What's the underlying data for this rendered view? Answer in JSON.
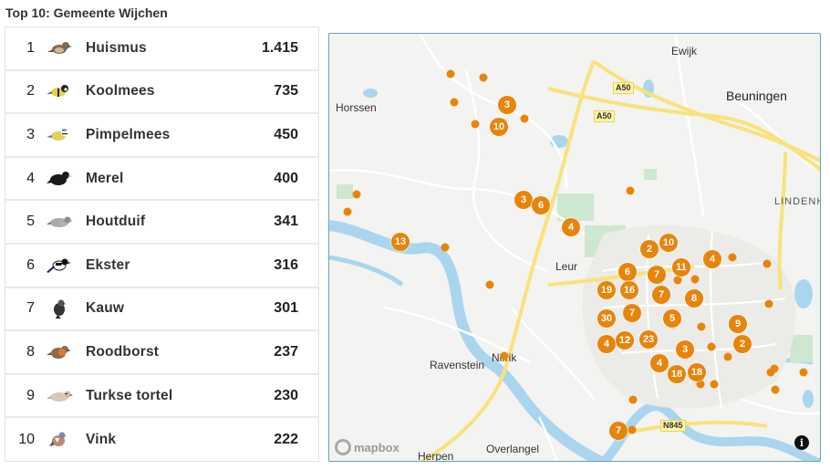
{
  "title": "Top 10: Gemeente Wijchen",
  "birds": [
    {
      "rank": "1",
      "name": "Huismus",
      "count": "1.415",
      "icon": "sparrow-icon"
    },
    {
      "rank": "2",
      "name": "Koolmees",
      "count": "735",
      "icon": "great-tit-icon"
    },
    {
      "rank": "3",
      "name": "Pimpelmees",
      "count": "450",
      "icon": "blue-tit-icon"
    },
    {
      "rank": "4",
      "name": "Merel",
      "count": "400",
      "icon": "blackbird-icon"
    },
    {
      "rank": "5",
      "name": "Houtduif",
      "count": "341",
      "icon": "wood-pigeon-icon"
    },
    {
      "rank": "6",
      "name": "Ekster",
      "count": "316",
      "icon": "magpie-icon"
    },
    {
      "rank": "7",
      "name": "Kauw",
      "count": "301",
      "icon": "jackdaw-icon"
    },
    {
      "rank": "8",
      "name": "Roodborst",
      "count": "237",
      "icon": "robin-icon"
    },
    {
      "rank": "9",
      "name": "Turkse tortel",
      "count": "230",
      "icon": "collared-dove-icon"
    },
    {
      "rank": "10",
      "name": "Vink",
      "count": "222",
      "icon": "chaffinch-icon"
    }
  ],
  "map": {
    "places": {
      "ewijk": "Ewijk",
      "beuningen": "Beuningen",
      "horssen": "Horssen",
      "lindenholt": "LINDENH",
      "leur": "Leur",
      "ravenstein": "Ravenstein",
      "niftrik": "Nifrik",
      "herpen": "Herpen",
      "overlangel": "Overlangel"
    },
    "roads": {
      "a50_1": "A50",
      "a50_2": "A50",
      "n845": "N845"
    },
    "clusters": [
      "3",
      "10",
      "3",
      "6",
      "4",
      "13",
      "2",
      "10",
      "4",
      "11",
      "6",
      "7",
      "19",
      "16",
      "7",
      "8",
      "30",
      "7",
      "5",
      "9",
      "4",
      "12",
      "23",
      "2",
      "3",
      "4",
      "18",
      "18",
      "7"
    ],
    "attribution": "mapbox",
    "info": "i",
    "marker_color": "#e8840a"
  }
}
